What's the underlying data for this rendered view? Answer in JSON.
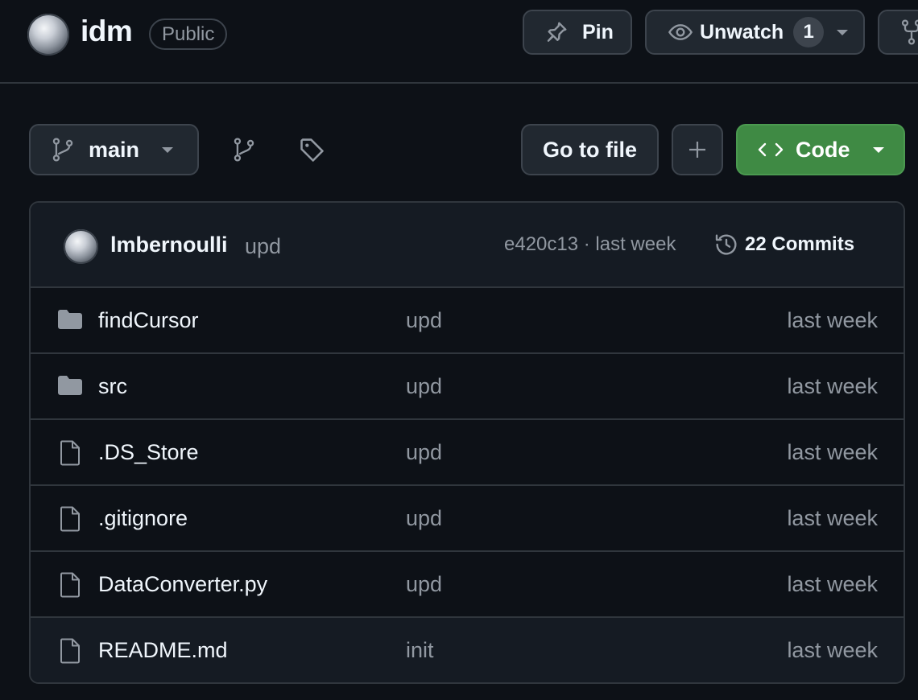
{
  "header": {
    "repo_name": "idm",
    "visibility": "Public",
    "pin_label": "Pin",
    "unwatch_label": "Unwatch",
    "watch_count": "1"
  },
  "toolbar": {
    "branch": "main",
    "goto_file_label": "Go to file",
    "add_label": "+",
    "code_label": "Code",
    "code_icon": "<>",
    "code_button_color": "#3f8a44"
  },
  "commit": {
    "author": "lmbernoulli",
    "message": "upd",
    "meta": "e420c13 · last week",
    "commits_label": "22 Commits"
  },
  "files": [
    {
      "name": "findCursor",
      "type": "folder",
      "message": "upd",
      "date": "last week",
      "icon": "folder-icon"
    },
    {
      "name": "src",
      "type": "folder",
      "message": "upd",
      "date": "last week",
      "icon": "folder-icon"
    },
    {
      "name": ".DS_Store",
      "type": "file",
      "message": "upd",
      "date": "last week",
      "icon": "file-icon"
    },
    {
      "name": ".gitignore",
      "type": "file",
      "message": "upd",
      "date": "last week",
      "icon": "file-icon"
    },
    {
      "name": "DataConverter.py",
      "type": "file",
      "message": "upd",
      "date": "last week",
      "icon": "file-icon"
    },
    {
      "name": "README.md",
      "type": "file",
      "message": "init",
      "date": "last week",
      "icon": "file-icon"
    }
  ],
  "colors": {
    "background": "#0d1117",
    "border": "#30363d",
    "muted_text": "#9198a1",
    "text": "#f0f6fc",
    "folder_icon": "#9198a1"
  }
}
